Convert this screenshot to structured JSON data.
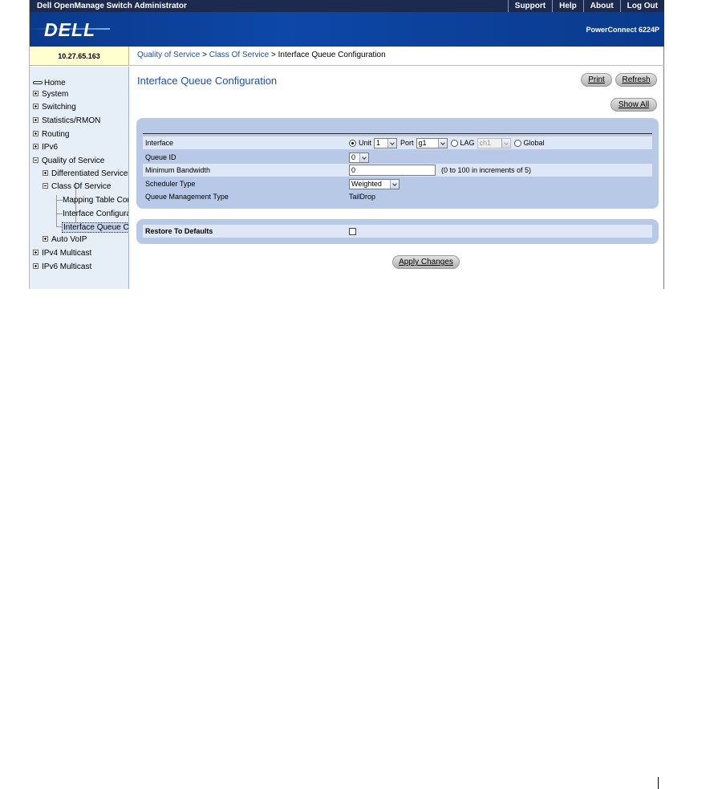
{
  "topbar": {
    "title": "Dell OpenManage Switch Administrator",
    "links": [
      "Support",
      "Help",
      "About",
      "Log Out"
    ]
  },
  "banner": {
    "logo": "DELL",
    "model": "PowerConnect 6224P"
  },
  "ip_address": "10.27.65.163",
  "breadcrumb": {
    "part1": "Quality of Service",
    "sep1": " > ",
    "part2": "Class Of Service",
    "sep2": " > ",
    "current": "Interface Queue Configuration"
  },
  "sidebar": {
    "home": "Home",
    "system": "System",
    "switching": "Switching",
    "statistics": "Statistics/RMON",
    "routing": "Routing",
    "ipv6": "IPv6",
    "qos": "Quality of Service",
    "diffserv": "Differentiated Services",
    "cos": "Class Of Service",
    "mapping": "Mapping Table Configuration",
    "interface_conf": "Interface Configuration",
    "interface_queue": "Interface Queue Configuration",
    "autovoip": "Auto VoIP",
    "ipv4mc": "IPv4 Multicast",
    "ipv6mc": "IPv6 Multicast"
  },
  "page": {
    "title": "Interface Queue Configuration",
    "print": "Print",
    "refresh": "Refresh",
    "show_all": "Show All"
  },
  "form": {
    "interface_label": "Interface",
    "unit_label": "Unit",
    "unit_value": "1",
    "port_label": "Port",
    "port_value": "g1",
    "lag_label": "LAG",
    "lag_value": "ch1",
    "global_label": "Global",
    "queue_id_label": "Queue ID",
    "queue_id_value": "0",
    "min_bw_label": "Minimum Bandwidth",
    "min_bw_value": "0",
    "min_bw_hint": "(0 to 100 in increments of 5)",
    "scheduler_label": "Scheduler Type",
    "scheduler_value": "Weighted",
    "qmgmt_label": "Queue Management Type",
    "qmgmt_value": "TailDrop",
    "restore_label": "Restore To Defaults",
    "apply": "Apply Changes"
  }
}
